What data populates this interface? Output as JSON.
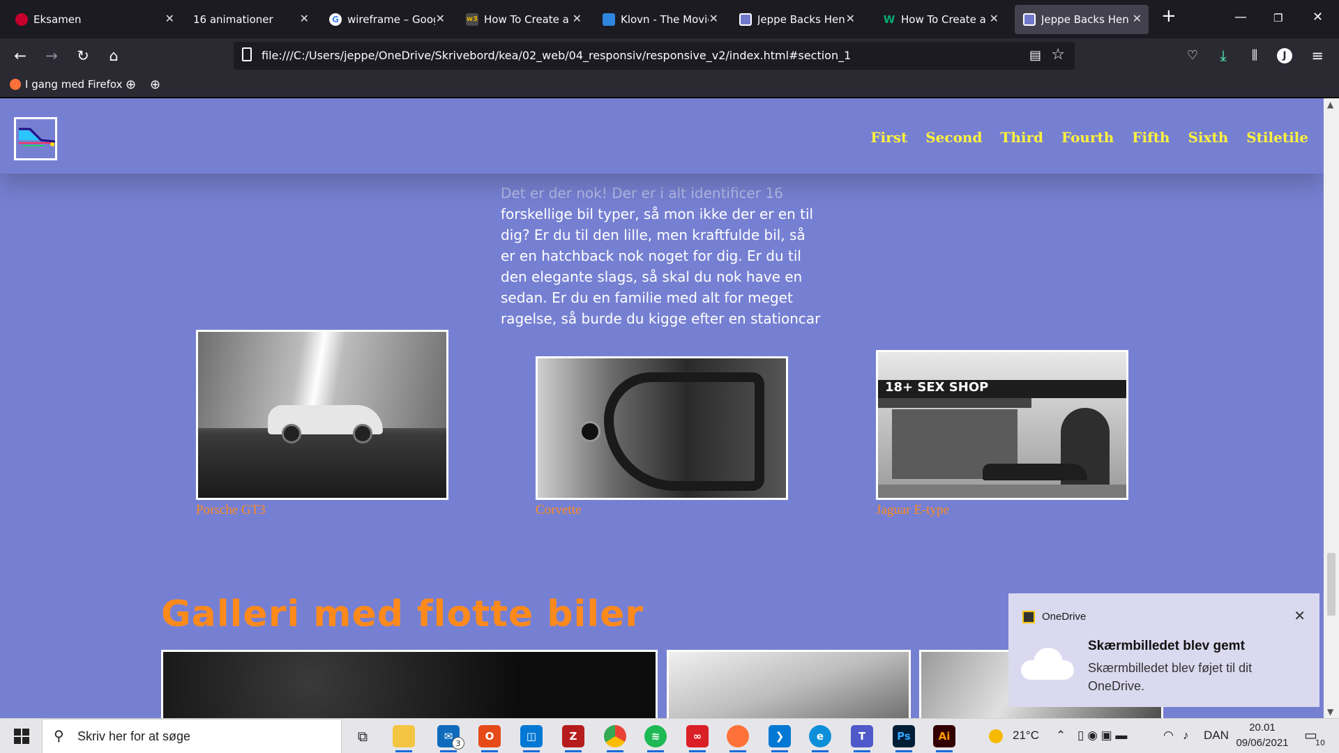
{
  "browser": {
    "tabs": [
      {
        "title": "Eksamen",
        "icon": "eksamen-icon",
        "color": "#c6002b",
        "active": false
      },
      {
        "title": "16 animationer",
        "icon": "",
        "color": "",
        "active": false
      },
      {
        "title": "wireframe – Googl",
        "icon": "google-icon",
        "color": "#ffffff",
        "active": false
      },
      {
        "title": "How To Create a G",
        "icon": "w3schools-icon",
        "color": "#4a4a4a",
        "active": false
      },
      {
        "title": "Klovn - The Movie",
        "icon": "image-icon",
        "color": "#2e86de",
        "active": false
      },
      {
        "title": "Jeppe Backs Henrik",
        "icon": "page-icon",
        "color": "#6f78c9",
        "active": false
      },
      {
        "title": "How To Create a M",
        "icon": "w-icon",
        "color": "#04aa6d",
        "active": false
      },
      {
        "title": "Jeppe Backs Henrik",
        "icon": "page-icon",
        "color": "#6f78c9",
        "active": true
      }
    ],
    "url": "file:///C:/Users/jeppe/OneDrive/Skrivebord/kea/02_web/04_responsiv/responsive_v2/index.html#section_1",
    "bookmarks": {
      "first": "I gang med Firefox"
    }
  },
  "site": {
    "nav": [
      "First",
      "Second",
      "Third",
      "Fourth",
      "Fifth",
      "Sixth",
      "Stiletile"
    ],
    "intro_faded": "Det er der nok! Der er i alt identificer 16",
    "intro_text": "forskellige bil typer, så mon ikke der er en til dig? Er du til den lille, men kraftfulde bil, så er en hatchback nok noget for dig. Er du til den elegante slags, så skal du nok have en sedan. Er du en familie med alt for meget ragelse, så burde du kigge efter en stationcar",
    "cars": [
      {
        "caption": "Porsche GT3"
      },
      {
        "caption": "Corvette"
      },
      {
        "caption": "Jaguar E-type",
        "sign": "18+ SEX SHOP"
      }
    ],
    "gallery_title": "Galleri med flotte biler"
  },
  "toast": {
    "app": "OneDrive",
    "title": "Skærmbilledet blev gemt",
    "body": "Skærmbilledet blev føjet til dit OneDrive."
  },
  "taskbar": {
    "search_placeholder": "Skriv her for at søge",
    "mail_badge": "3",
    "weather": "21°C",
    "language": "DAN",
    "time": "20.01",
    "date": "09/06/2021",
    "notifications": "10"
  }
}
